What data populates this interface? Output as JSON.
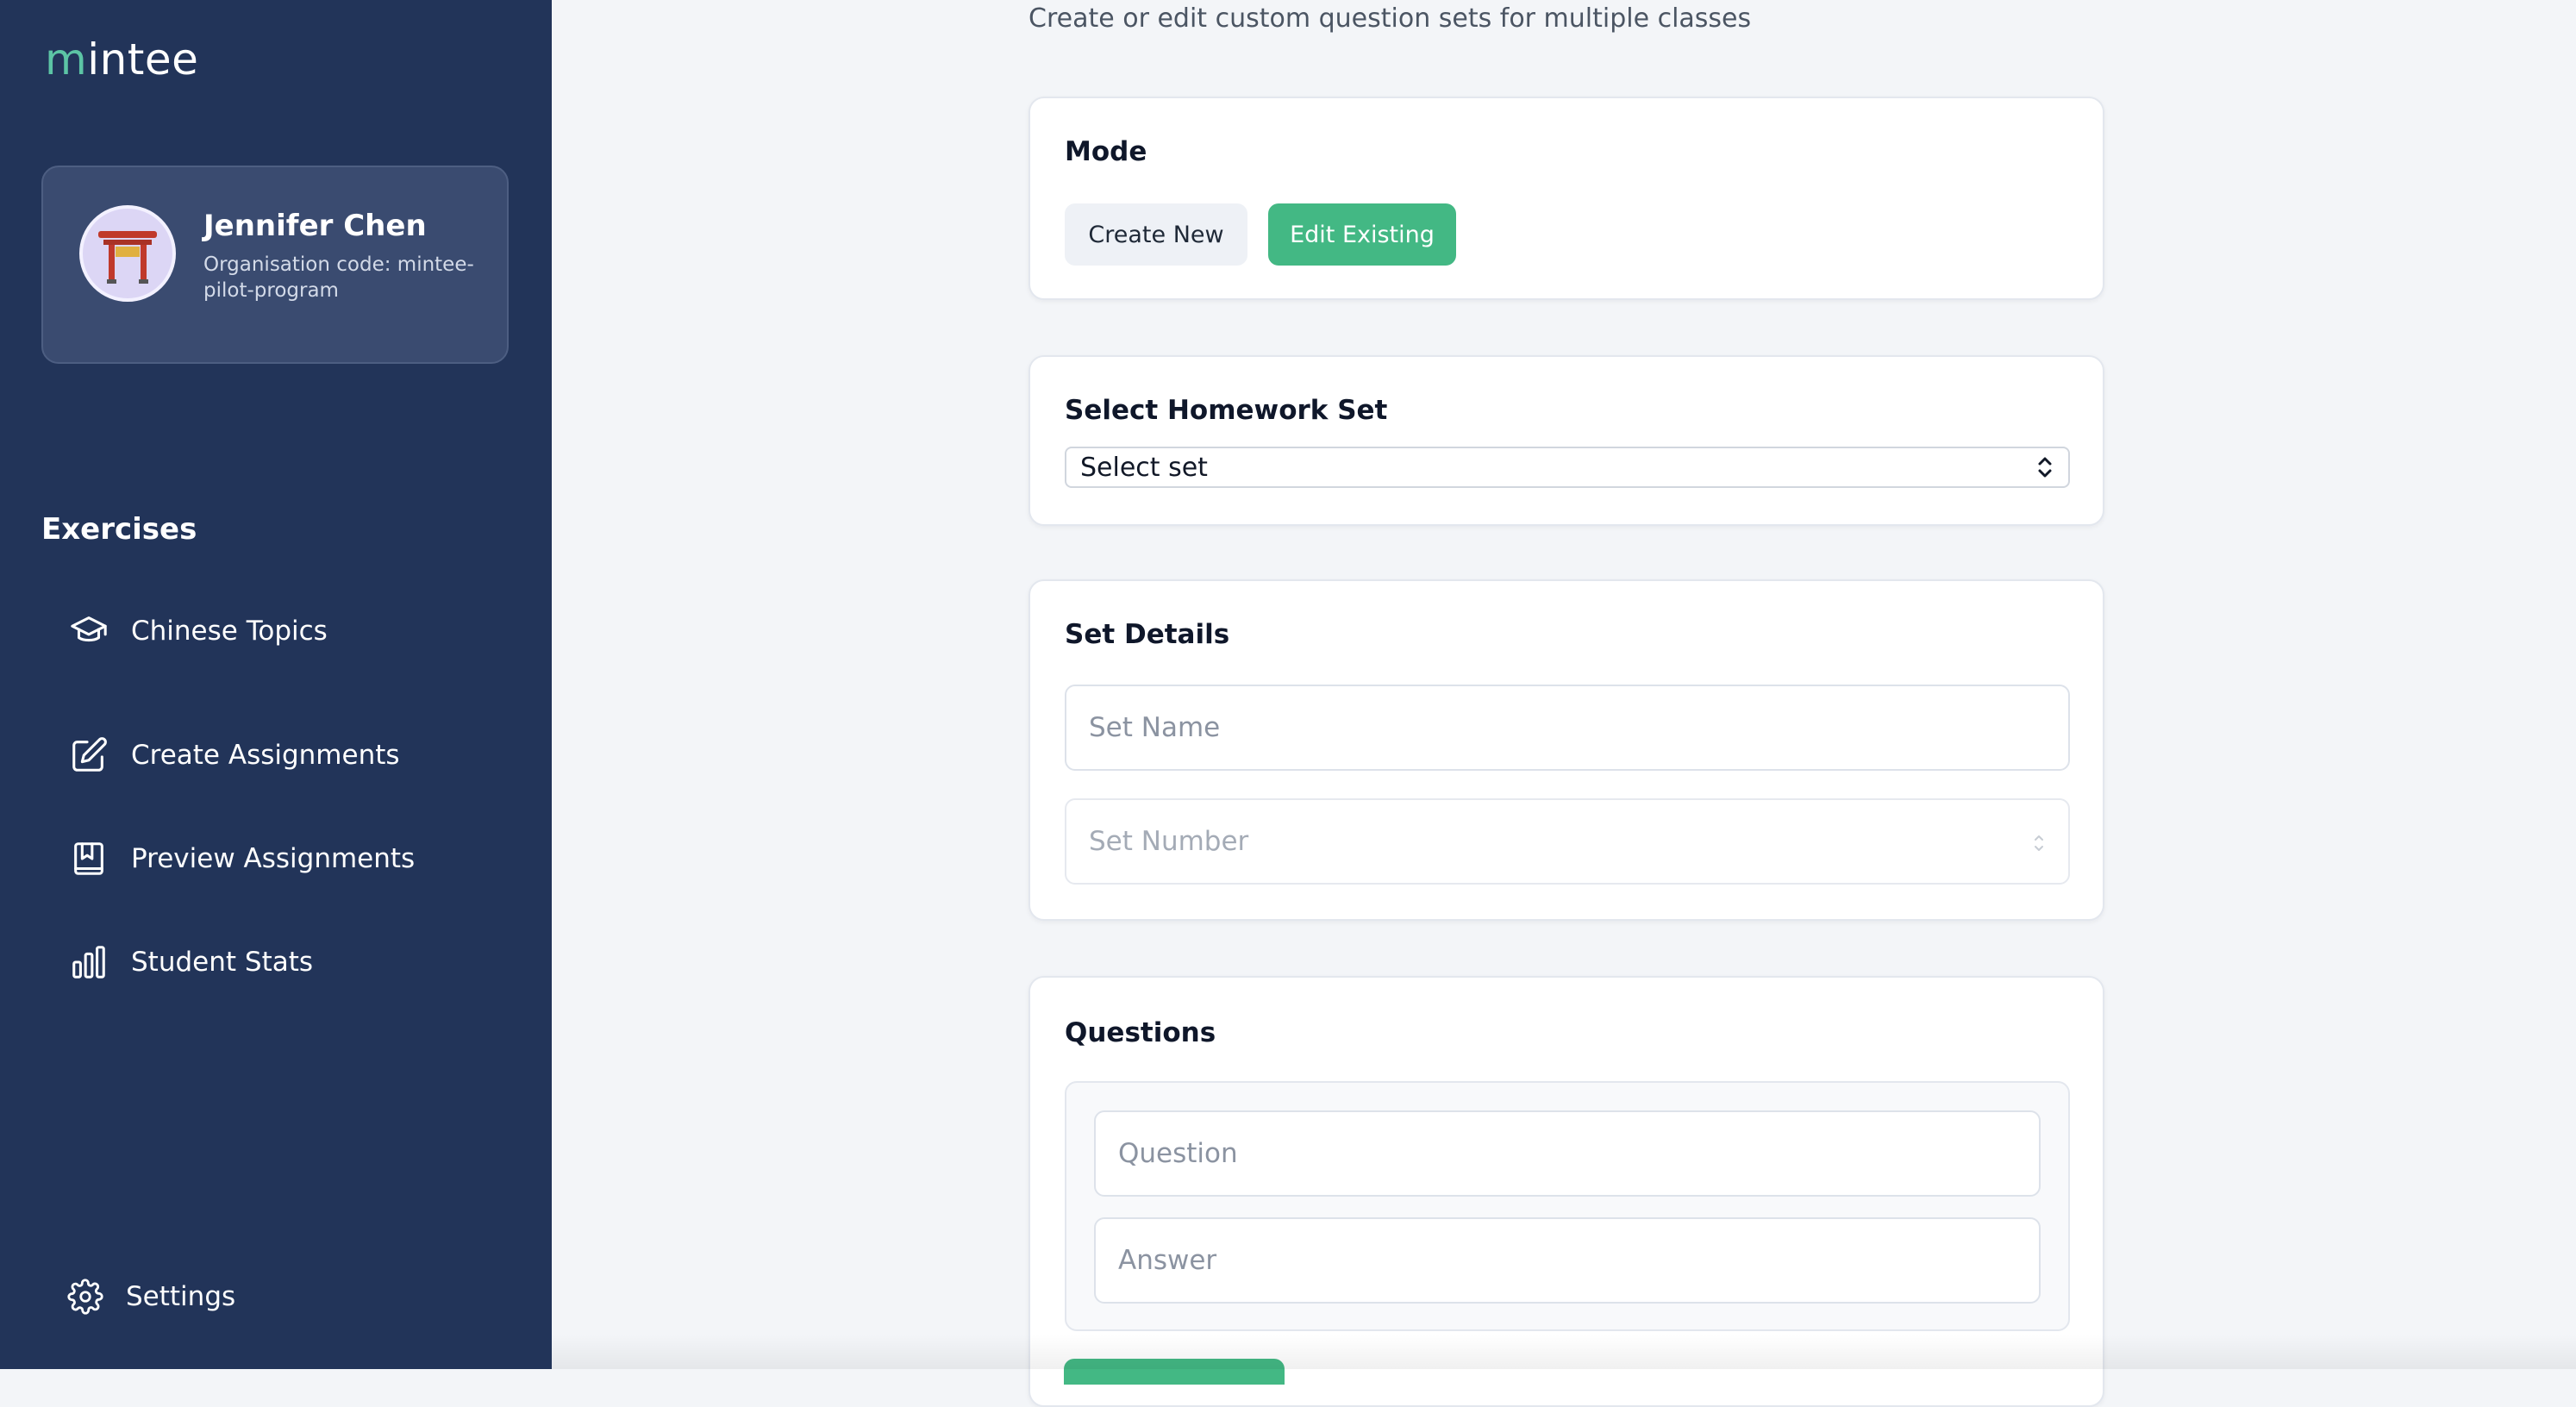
{
  "app": {
    "logo_text": "intee",
    "logo_mark": "m"
  },
  "profile": {
    "name": "Jennifer Chen",
    "org_line": "Organisation code: mintee-pilot-program",
    "avatar_icon": "torii-gate-icon"
  },
  "sidebar": {
    "section_title": "Exercises",
    "items": [
      {
        "label": "Chinese Topics",
        "icon": "graduation-cap-icon"
      },
      {
        "label": "Create Assignments",
        "icon": "edit-icon"
      },
      {
        "label": "Preview Assignments",
        "icon": "bookmark-book-icon"
      },
      {
        "label": "Student Stats",
        "icon": "bar-chart-icon"
      }
    ],
    "settings_label": "Settings"
  },
  "main": {
    "subtitle": "Create or edit custom question sets for multiple classes",
    "mode": {
      "title": "Mode",
      "create_label": "Create New",
      "edit_label": "Edit Existing",
      "active": "Edit Existing"
    },
    "homework": {
      "title": "Select Homework Set",
      "selected": "Select set"
    },
    "details": {
      "title": "Set Details",
      "name_placeholder": "Set Name",
      "number_placeholder": "Set Number"
    },
    "questions": {
      "title": "Questions",
      "question_placeholder": "Question",
      "answer_placeholder": "Answer"
    }
  },
  "colors": {
    "sidebar_bg": "#223459",
    "accent": "#43b884",
    "page_bg": "#f3f5f8"
  }
}
